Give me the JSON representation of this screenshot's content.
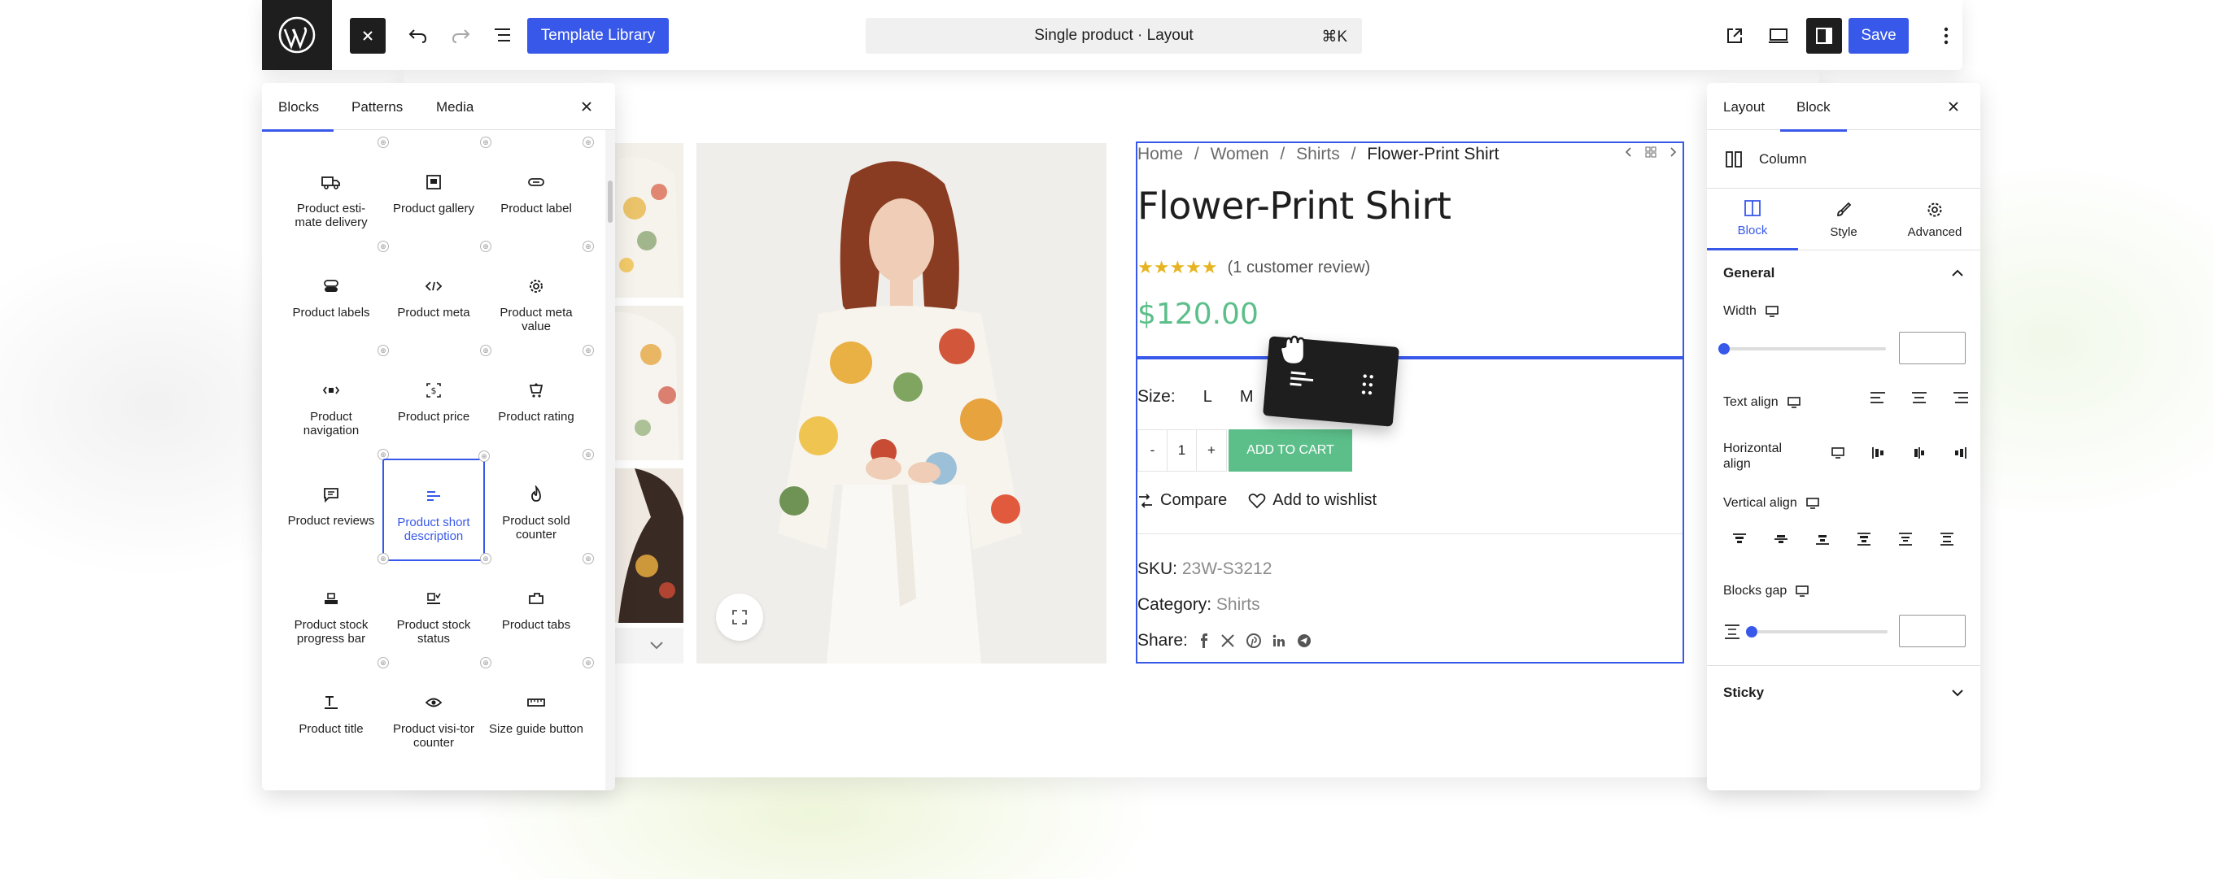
{
  "topbar": {
    "template_library_label": "Template Library",
    "document_title": "Single product · Layout",
    "shortcut": "⌘K",
    "save_label": "Save"
  },
  "inserter": {
    "tabs": [
      "Blocks",
      "Patterns",
      "Media"
    ],
    "active_tab": "Blocks",
    "blocks": [
      {
        "label": "Product esti-mate delivery",
        "icon": "truck-icon"
      },
      {
        "label": "Product gallery",
        "icon": "gallery-icon"
      },
      {
        "label": "Product label",
        "icon": "tag-icon"
      },
      {
        "label": "Product labels",
        "icon": "tags-icon"
      },
      {
        "label": "Product meta",
        "icon": "code-icon"
      },
      {
        "label": "Product meta value",
        "icon": "gear-icon"
      },
      {
        "label": "Product navigation",
        "icon": "navigation-icon"
      },
      {
        "label": "Product price",
        "icon": "price-icon"
      },
      {
        "label": "Product rating",
        "icon": "rating-icon"
      },
      {
        "label": "Product reviews",
        "icon": "comment-icon"
      },
      {
        "label": "Product short description",
        "icon": "short-description-icon"
      },
      {
        "label": "Product sold counter",
        "icon": "fire-icon"
      },
      {
        "label": "Product stock progress bar",
        "icon": "stock-bar-icon"
      },
      {
        "label": "Product stock status",
        "icon": "stock-status-icon"
      },
      {
        "label": "Product tabs",
        "icon": "tabs-icon"
      },
      {
        "label": "Product title",
        "icon": "title-icon"
      },
      {
        "label": "Product visi-tor counter",
        "icon": "eye-icon"
      },
      {
        "label": "Size guide button",
        "icon": "ruler-icon"
      }
    ],
    "selected_block": "Product short description"
  },
  "product": {
    "breadcrumb": [
      "Home",
      "Women",
      "Shirts",
      "Flower-Print Shirt"
    ],
    "breadcrumb_sep": "/",
    "title": "Flower-Print Shirt",
    "stars": "★★★★★",
    "review_text": "(1 customer review)",
    "price": "$120.00",
    "size_label": "Size:",
    "sizes": [
      "L",
      "M"
    ],
    "qty_minus": "-",
    "qty_value": "1",
    "qty_plus": "+",
    "add_to_cart": "ADD TO CART",
    "compare_label": "Compare",
    "wishlist_label": "Add to wishlist",
    "sku_label": "SKU:",
    "sku_value": "23W-S3212",
    "category_label": "Category:",
    "category_value": "Shirts",
    "share_label": "Share:",
    "share_icons": [
      "facebook-icon",
      "x-icon",
      "pinterest-icon",
      "linkedin-icon",
      "telegram-icon"
    ]
  },
  "settings": {
    "tabs": [
      "Layout",
      "Block"
    ],
    "active_tab": "Block",
    "block_name": "Column",
    "sub_tabs": [
      "Block",
      "Style",
      "Advanced"
    ],
    "active_sub_tab": "Block",
    "general_label": "General",
    "width_label": "Width",
    "text_align_label": "Text align",
    "horizontal_align_label": "Horizontal align",
    "vertical_align_label": "Vertical align",
    "blocks_gap_label": "Blocks gap",
    "sticky_label": "Sticky"
  },
  "colors": {
    "accent": "#3858e9",
    "price_green": "#5cbf8a",
    "star_gold": "#e6b422",
    "dark": "#1e1e1e"
  }
}
